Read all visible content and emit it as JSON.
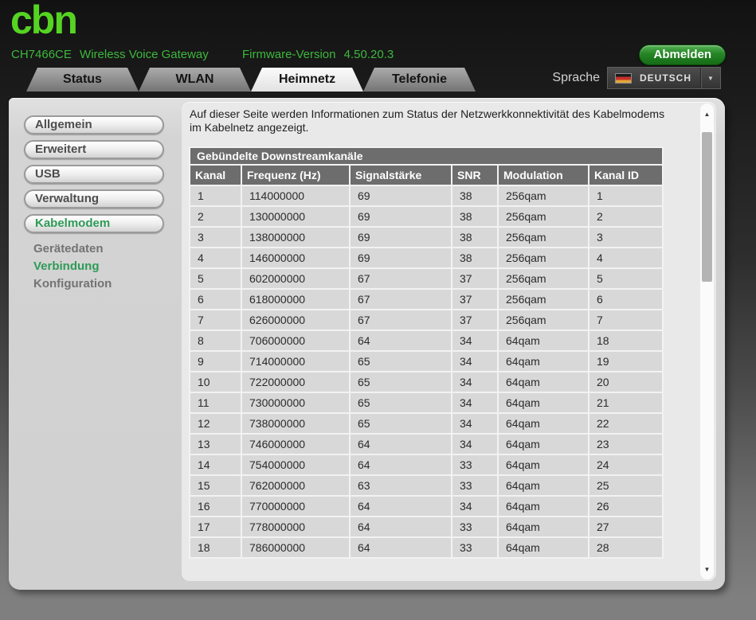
{
  "colors": {
    "brand_green": "#55d422",
    "header_green": "#3db83d",
    "active_green": "#2e9b57",
    "logout_green": "#258525"
  },
  "header": {
    "logo_text": "cbn",
    "model": "CH7466CE",
    "product_name": "Wireless Voice Gateway",
    "firmware_label": "Firmware-Version",
    "firmware_version": "4.50.20.3",
    "logout_button": "Abmelden",
    "language_label": "Sprache",
    "language_selected": "DEUTSCH"
  },
  "tabs": [
    {
      "label": "Status",
      "active": false
    },
    {
      "label": "WLAN",
      "active": false
    },
    {
      "label": "Heimnetz",
      "active": true
    },
    {
      "label": "Telefonie",
      "active": false
    }
  ],
  "sidebar": {
    "buttons": [
      {
        "label": "Allgemein",
        "active": false
      },
      {
        "label": "Erweitert",
        "active": false
      },
      {
        "label": "USB",
        "active": false
      },
      {
        "label": "Verwaltung",
        "active": false
      },
      {
        "label": "Kabelmodem",
        "active": true
      }
    ],
    "subitems": [
      {
        "label": "Gerätedaten",
        "active": false
      },
      {
        "label": "Verbindung",
        "active": true
      },
      {
        "label": "Konfiguration",
        "active": false
      }
    ]
  },
  "main": {
    "intro": "Auf dieser Seite werden Informationen zum Status der Netzwerkkonnektivität des Kabelmodems im Kabelnetz angezeigt.",
    "table": {
      "title": "Gebündelte Downstreamkanäle",
      "columns": [
        "Kanal",
        "Frequenz (Hz)",
        "Signalstärke",
        "SNR",
        "Modulation",
        "Kanal ID"
      ],
      "rows": [
        [
          "1",
          "114000000",
          "69",
          "38",
          "256qam",
          "1"
        ],
        [
          "2",
          "130000000",
          "69",
          "38",
          "256qam",
          "2"
        ],
        [
          "3",
          "138000000",
          "69",
          "38",
          "256qam",
          "3"
        ],
        [
          "4",
          "146000000",
          "69",
          "38",
          "256qam",
          "4"
        ],
        [
          "5",
          "602000000",
          "67",
          "37",
          "256qam",
          "5"
        ],
        [
          "6",
          "618000000",
          "67",
          "37",
          "256qam",
          "6"
        ],
        [
          "7",
          "626000000",
          "67",
          "37",
          "256qam",
          "7"
        ],
        [
          "8",
          "706000000",
          "64",
          "34",
          "64qam",
          "18"
        ],
        [
          "9",
          "714000000",
          "65",
          "34",
          "64qam",
          "19"
        ],
        [
          "10",
          "722000000",
          "65",
          "34",
          "64qam",
          "20"
        ],
        [
          "11",
          "730000000",
          "65",
          "34",
          "64qam",
          "21"
        ],
        [
          "12",
          "738000000",
          "65",
          "34",
          "64qam",
          "22"
        ],
        [
          "13",
          "746000000",
          "64",
          "34",
          "64qam",
          "23"
        ],
        [
          "14",
          "754000000",
          "64",
          "33",
          "64qam",
          "24"
        ],
        [
          "15",
          "762000000",
          "63",
          "33",
          "64qam",
          "25"
        ],
        [
          "16",
          "770000000",
          "64",
          "34",
          "64qam",
          "26"
        ],
        [
          "17",
          "778000000",
          "64",
          "33",
          "64qam",
          "27"
        ],
        [
          "18",
          "786000000",
          "64",
          "33",
          "64qam",
          "28"
        ]
      ]
    }
  }
}
